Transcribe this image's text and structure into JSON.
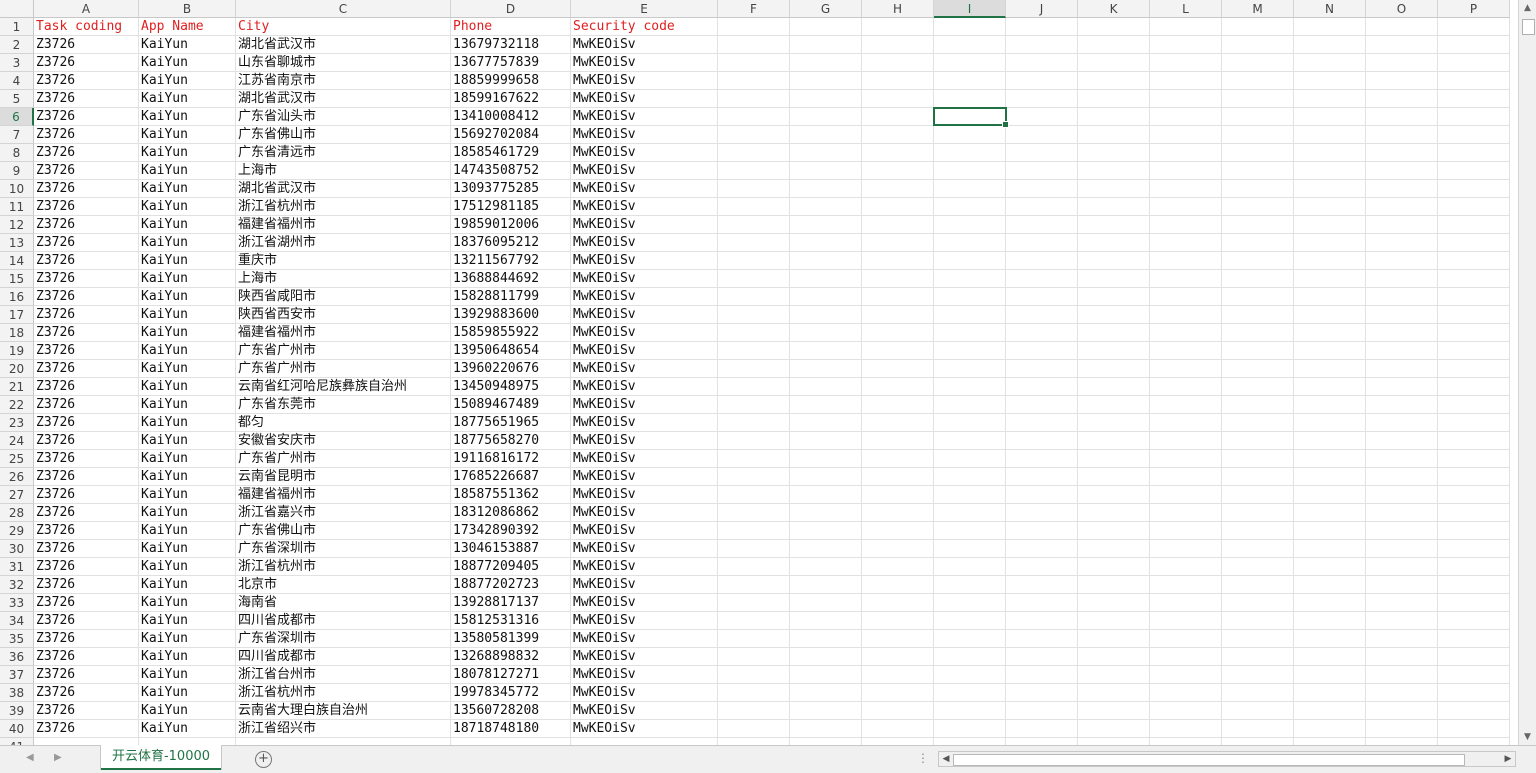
{
  "columns": [
    "A",
    "B",
    "C",
    "D",
    "E",
    "F",
    "G",
    "H",
    "I",
    "J",
    "K",
    "L",
    "M",
    "N",
    "O",
    "P"
  ],
  "selected_cell": {
    "column": "I",
    "row": 6
  },
  "headers": [
    "Task coding",
    "App Name",
    "City",
    "Phone",
    "Security code"
  ],
  "rows": [
    [
      "Z3726",
      "KaiYun",
      "湖北省武汉市",
      "13679732118",
      "MwKEOiSv"
    ],
    [
      "Z3726",
      "KaiYun",
      "山东省聊城市",
      "13677757839",
      "MwKEOiSv"
    ],
    [
      "Z3726",
      "KaiYun",
      "江苏省南京市",
      "18859999658",
      "MwKEOiSv"
    ],
    [
      "Z3726",
      "KaiYun",
      "湖北省武汉市",
      "18599167622",
      "MwKEOiSv"
    ],
    [
      "Z3726",
      "KaiYun",
      "广东省汕头市",
      "13410008412",
      "MwKEOiSv"
    ],
    [
      "Z3726",
      "KaiYun",
      "广东省佛山市",
      "15692702084",
      "MwKEOiSv"
    ],
    [
      "Z3726",
      "KaiYun",
      "广东省清远市",
      "18585461729",
      "MwKEOiSv"
    ],
    [
      "Z3726",
      "KaiYun",
      "上海市",
      "14743508752",
      "MwKEOiSv"
    ],
    [
      "Z3726",
      "KaiYun",
      "湖北省武汉市",
      "13093775285",
      "MwKEOiSv"
    ],
    [
      "Z3726",
      "KaiYun",
      "浙江省杭州市",
      "17512981185",
      "MwKEOiSv"
    ],
    [
      "Z3726",
      "KaiYun",
      "福建省福州市",
      "19859012006",
      "MwKEOiSv"
    ],
    [
      "Z3726",
      "KaiYun",
      "浙江省湖州市",
      "18376095212",
      "MwKEOiSv"
    ],
    [
      "Z3726",
      "KaiYun",
      "重庆市",
      "13211567792",
      "MwKEOiSv"
    ],
    [
      "Z3726",
      "KaiYun",
      "上海市",
      "13688844692",
      "MwKEOiSv"
    ],
    [
      "Z3726",
      "KaiYun",
      "陕西省咸阳市",
      "15828811799",
      "MwKEOiSv"
    ],
    [
      "Z3726",
      "KaiYun",
      "陕西省西安市",
      "13929883600",
      "MwKEOiSv"
    ],
    [
      "Z3726",
      "KaiYun",
      "福建省福州市",
      "15859855922",
      "MwKEOiSv"
    ],
    [
      "Z3726",
      "KaiYun",
      "广东省广州市",
      "13950648654",
      "MwKEOiSv"
    ],
    [
      "Z3726",
      "KaiYun",
      "广东省广州市",
      "13960220676",
      "MwKEOiSv"
    ],
    [
      "Z3726",
      "KaiYun",
      "云南省红河哈尼族彝族自治州",
      "13450948975",
      "MwKEOiSv"
    ],
    [
      "Z3726",
      "KaiYun",
      "广东省东莞市",
      "15089467489",
      "MwKEOiSv"
    ],
    [
      "Z3726",
      "KaiYun",
      "都匀",
      "18775651965",
      "MwKEOiSv"
    ],
    [
      "Z3726",
      "KaiYun",
      "安徽省安庆市",
      "18775658270",
      "MwKEOiSv"
    ],
    [
      "Z3726",
      "KaiYun",
      "广东省广州市",
      "19116816172",
      "MwKEOiSv"
    ],
    [
      "Z3726",
      "KaiYun",
      "云南省昆明市",
      "17685226687",
      "MwKEOiSv"
    ],
    [
      "Z3726",
      "KaiYun",
      "福建省福州市",
      "18587551362",
      "MwKEOiSv"
    ],
    [
      "Z3726",
      "KaiYun",
      "浙江省嘉兴市",
      "18312086862",
      "MwKEOiSv"
    ],
    [
      "Z3726",
      "KaiYun",
      "广东省佛山市",
      "17342890392",
      "MwKEOiSv"
    ],
    [
      "Z3726",
      "KaiYun",
      "广东省深圳市",
      "13046153887",
      "MwKEOiSv"
    ],
    [
      "Z3726",
      "KaiYun",
      "浙江省杭州市",
      "18877209405",
      "MwKEOiSv"
    ],
    [
      "Z3726",
      "KaiYun",
      "北京市",
      "18877202723",
      "MwKEOiSv"
    ],
    [
      "Z3726",
      "KaiYun",
      "海南省",
      "13928817137",
      "MwKEOiSv"
    ],
    [
      "Z3726",
      "KaiYun",
      "四川省成都市",
      "15812531316",
      "MwKEOiSv"
    ],
    [
      "Z3726",
      "KaiYun",
      "广东省深圳市",
      "13580581399",
      "MwKEOiSv"
    ],
    [
      "Z3726",
      "KaiYun",
      "四川省成都市",
      "13268898832",
      "MwKEOiSv"
    ],
    [
      "Z3726",
      "KaiYun",
      "浙江省台州市",
      "18078127271",
      "MwKEOiSv"
    ],
    [
      "Z3726",
      "KaiYun",
      "浙江省杭州市",
      "19978345772",
      "MwKEOiSv"
    ],
    [
      "Z3726",
      "KaiYun",
      "云南省大理白族自治州",
      "13560728208",
      "MwKEOiSv"
    ],
    [
      "Z3726",
      "KaiYun",
      "浙江省绍兴市",
      "18718748180",
      "MwKEOiSv"
    ]
  ],
  "sheet_tab": "开云体育-10000",
  "colors": {
    "header_text": "#e02020",
    "accent": "#217346"
  },
  "icons": {
    "add_sheet": "plus-circle-icon",
    "prev": "triangle-left-icon",
    "next": "triangle-right-icon"
  }
}
